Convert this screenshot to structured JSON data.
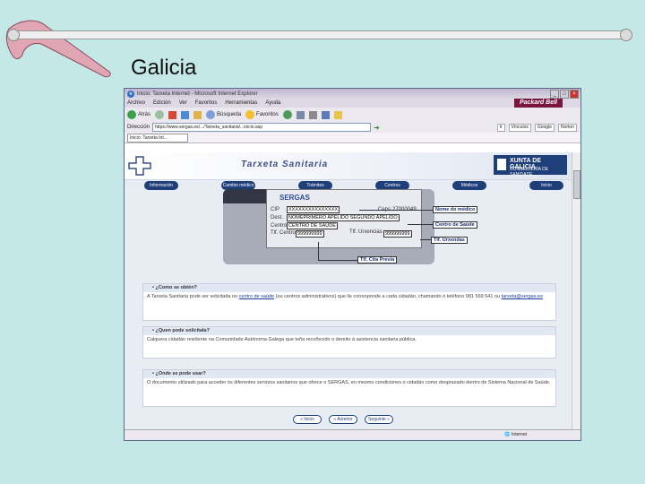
{
  "slide": {
    "title": "Galicia"
  },
  "browser": {
    "window_title": "Inicio: Tarxeta Internet - Microsoft Internet Explorer",
    "brand": "Packard Bell",
    "menu": [
      "Archivo",
      "Edición",
      "Ver",
      "Favoritos",
      "Herramientas",
      "Ayuda"
    ],
    "toolbar": {
      "back": "Atrás",
      "search": "Búsqueda",
      "favorites": "Favoritos"
    },
    "address_label": "Dirección",
    "address": "https://www.sergas.es/.../Tarxeta_sanitaria/...inicio.asp",
    "links": [
      "Ir",
      "Vínculos",
      "Google",
      "Norton"
    ],
    "tab": "Inicio: Tarxeta Int...",
    "status_left": "",
    "status_right": "Internet"
  },
  "page": {
    "banner_title": "Tarxeta Sanitaria",
    "xunta": {
      "line1": "XUNTA DE GALICIA",
      "line2": "CONSELLERÍA DE SANIDADE"
    },
    "nav": [
      "Información",
      "Cambio médico",
      "Trámites",
      "Centros",
      "Médicos",
      "Inicio"
    ],
    "card": {
      "logo": "SERGAS",
      "cip_label": "CIP",
      "cip": "XXXXXXXXXXXXXXX",
      "ceps_label": "Ceps",
      "ceps": "27000049",
      "dest_label": "Dest.",
      "name": "NOMEPRIMERO APELIDO SEGUNDO APELIDO",
      "centre_label": "Centro",
      "centre": "CENTRO DE SAÚDE",
      "tlf_centro_label": "Tlf. Centro",
      "tlf_centro": "999999999",
      "tlf_urgencias_label": "Tlf. Urxencias",
      "tlf_urgencias": "999999999"
    },
    "callouts": {
      "doctor": "Nome do médico",
      "centre": "Centro de Saúde",
      "urgent": "Tlf. Urxendas",
      "cita": "Tlf. Cita Previa"
    },
    "sections": [
      {
        "heading": "¿Como se obtén?",
        "pre": "A Tarxeta Sanitaria pode ser solicitada no ",
        "link": "centro de saúde",
        "post": " (ou centros administrativos) que lle corresponde a cada cidadán, chamando ó teléfono 981 569 541 ou",
        "link2": "tarxeta@sergas.es",
        "post2": ""
      },
      {
        "heading": "¿Quen pode solicitala?",
        "pre": "Calquera cidadán residente na Comunidade Autónoma Galega que teña recoñecido o dereito á asistencia sanitaria pública.",
        "link": "",
        "post": "",
        "link2": "",
        "post2": ""
      },
      {
        "heading": "¿Onde se pode usar?",
        "pre": "O documento utilizado para acceder ós diferentes servizos sanitarios que ofrece o SERGAS, en mesmo condiciones o cidadán como desprazado dentro de Sistema Nacional de Saúde.",
        "link": "",
        "post": "",
        "link2": "",
        "post2": ""
      }
    ],
    "bottom_nav": [
      "« Inicio",
      "« Anterior",
      "Seguinte »"
    ]
  },
  "colors": {
    "background": "#c4e8e6",
    "accent": "#1f3f7a",
    "brand": "#7a1540"
  }
}
